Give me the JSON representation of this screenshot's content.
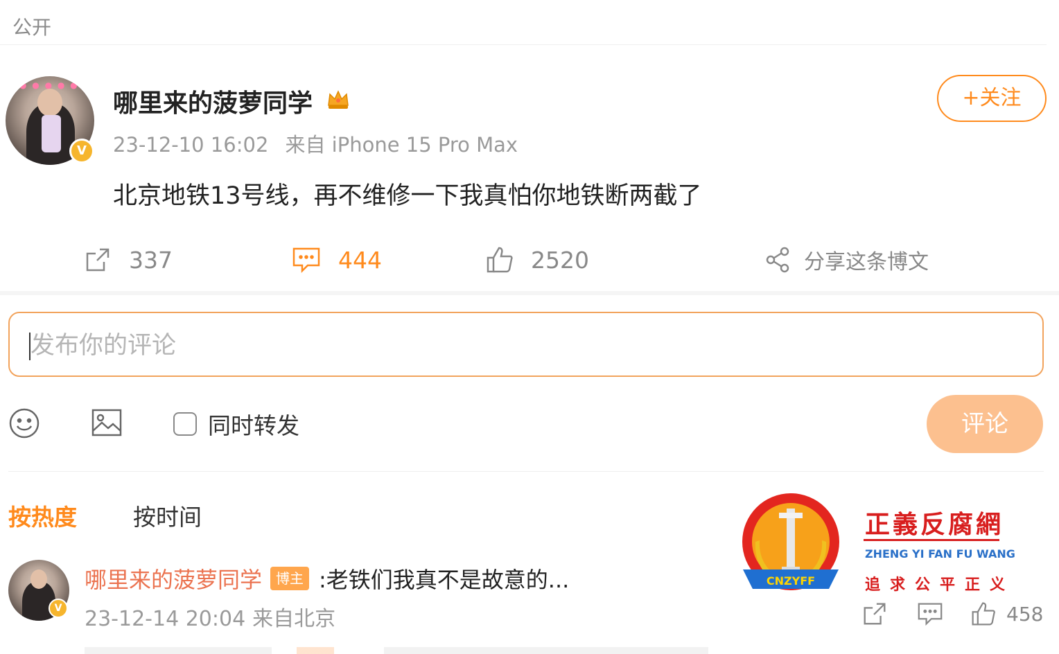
{
  "visibility_label": "公开",
  "post": {
    "username": "哪里来的菠萝同学",
    "timestamp": "23-12-10 16:02",
    "source": "来自 iPhone 15 Pro Max",
    "follow_label": "+关注",
    "content": "北京地铁13号线，再不维修一下我真怕你地铁断两截了",
    "repost_count": "337",
    "comment_count": "444",
    "like_count": "2520",
    "share_label": "分享这条博文"
  },
  "composer": {
    "placeholder": "发布你的评论",
    "repost_label": "同时转发",
    "submit_label": "评论"
  },
  "sort_tabs": [
    "按热度",
    "按时间"
  ],
  "comments": [
    {
      "username": "哪里来的菠萝同学",
      "badge": "博主",
      "text": ":老铁们我真不是故意的...",
      "timestamp": "23-12-14 20:04",
      "location": "来自北京",
      "like_count": "458"
    }
  ],
  "watermark": {
    "title": "正義反腐網",
    "pinyin": "ZHENG YI FAN FU WANG",
    "slogan": "追求公平正义",
    "emblem_text": "CNZYFF"
  },
  "colors": {
    "accent": "#ff8a1c",
    "comment_box_border": "#f2a35c",
    "submit_disabled": "#fcc08f",
    "commenter_name": "#eb7350",
    "watermark_red": "#d81e1e"
  }
}
